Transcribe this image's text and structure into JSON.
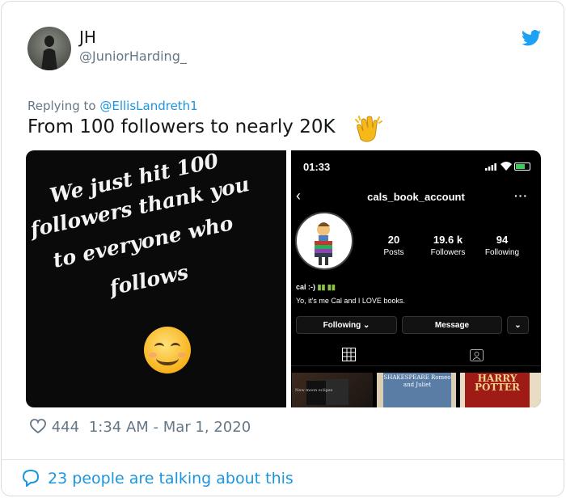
{
  "author": {
    "name": "JH",
    "handle": "@JuniorHarding_"
  },
  "reply": {
    "prefix": "Replying to",
    "to": "@EllisLandreth1"
  },
  "tweet": {
    "text": "From 100 followers to nearly 20K"
  },
  "left_image": {
    "lines": [
      "We just hit 100",
      "followers thank you",
      "to everyone who",
      "follows"
    ]
  },
  "right_image": {
    "time": "01:33",
    "account": "cals_book_account",
    "stats": [
      {
        "value": "20",
        "label": "Posts"
      },
      {
        "value": "19.6 k",
        "label": "Followers"
      },
      {
        "value": "94",
        "label": "Following"
      }
    ],
    "bio_name": "cal :-)",
    "bio_text": "Yo, it's me Cal and I LOVE books.",
    "follow_btn": "Following",
    "message_btn": "Message",
    "thumbs": [
      {
        "text": "New moon   eclipse"
      },
      {
        "text": "SHAKESPEARE Romeo and Juliet"
      },
      {
        "text": "HARRY POTTER"
      }
    ]
  },
  "meta": {
    "likes": "444",
    "timestamp": "1:34 AM - Mar 1, 2020"
  },
  "footer": {
    "talk": "23 people are talking about this"
  },
  "colors": {
    "link": "#1b95e0",
    "secondary": "#657786",
    "twitter": "#1da1f2"
  }
}
